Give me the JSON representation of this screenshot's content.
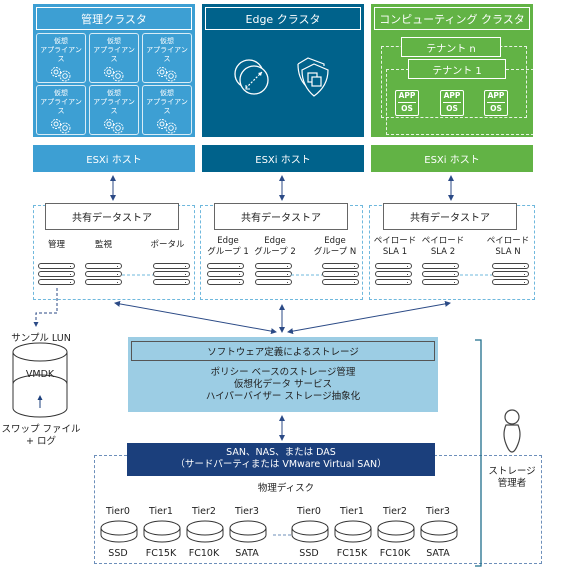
{
  "clusters": {
    "management": {
      "title": "管理クラスタ",
      "color": "#3d9fd3",
      "appliances": [
        {
          "line1": "仮想",
          "line2": "アプライアンス"
        },
        {
          "line1": "仮想",
          "line2": "アプライアンス"
        },
        {
          "line1": "仮想",
          "line2": "アプライアンス"
        },
        {
          "line1": "仮想",
          "line2": "アプライアンス"
        },
        {
          "line1": "仮想",
          "line2": "アプライアンス"
        },
        {
          "line1": "仮想",
          "line2": "アプライアンス"
        }
      ]
    },
    "edge": {
      "title": "Edge クラスタ",
      "color": "#00628b",
      "icons": [
        "load-balancer-icon",
        "firewall-shield-icon"
      ]
    },
    "compute": {
      "title": "コンピューティング クラスタ",
      "color": "#62b345",
      "tenants": [
        "テナント n",
        "テナント 1"
      ],
      "vms": [
        {
          "app": "APP",
          "os": "OS"
        },
        {
          "app": "APP",
          "os": "OS"
        },
        {
          "app": "APP",
          "os": "OS"
        }
      ]
    }
  },
  "esxi_hosts": [
    {
      "label": "ESXi ホスト",
      "color": "#3d9fd3"
    },
    {
      "label": "ESXi ホスト",
      "color": "#00628b"
    },
    {
      "label": "ESXi ホスト",
      "color": "#62b345"
    }
  ],
  "datastores": [
    {
      "title": "共有データストア",
      "groups": [
        [
          "管理"
        ],
        [
          "監視"
        ],
        [
          "ポータル"
        ]
      ]
    },
    {
      "title": "共有データストア",
      "groups": [
        [
          "Edge",
          "グループ 1"
        ],
        [
          "Edge",
          "グループ 2"
        ],
        [
          "Edge",
          "グループ N"
        ]
      ]
    },
    {
      "title": "共有データストア",
      "groups": [
        [
          "ペイロード",
          "SLA 1"
        ],
        [
          "ペイロード",
          "SLA 2"
        ],
        [
          "ペイロード",
          "SLA N"
        ]
      ]
    }
  ],
  "sample_lun": {
    "title": "サンプル LUN",
    "top_label": "VMDK",
    "bottom_line1": "スワップ ファイル",
    "bottom_line2": "+ ログ"
  },
  "sds": {
    "title": "ソフトウェア定義によるストレージ",
    "lines": [
      "ポリシー ベースのストレージ管理",
      "仮想化データ サービス",
      "ハイパーバイザー ストレージ抽象化"
    ],
    "color": "#9ccde4"
  },
  "san": {
    "line1": "SAN、NAS、または DAS",
    "line2": "（サードパーティまたは VMware Virtual SAN）",
    "color": "#1b3f7c"
  },
  "physical_disks": {
    "title": "物理ディスク",
    "disks": [
      {
        "tier": "Tier0",
        "type": "SSD"
      },
      {
        "tier": "Tier1",
        "type": "FC15K"
      },
      {
        "tier": "Tier2",
        "type": "FC10K"
      },
      {
        "tier": "Tier3",
        "type": "SATA"
      },
      {
        "tier": "Tier0",
        "type": "SSD"
      },
      {
        "tier": "Tier1",
        "type": "FC15K"
      },
      {
        "tier": "Tier2",
        "type": "FC10K"
      },
      {
        "tier": "Tier3",
        "type": "SATA"
      }
    ]
  },
  "storage_admin": {
    "line1": "ストレージ",
    "line2": "管理者",
    "icon": "person-icon"
  }
}
